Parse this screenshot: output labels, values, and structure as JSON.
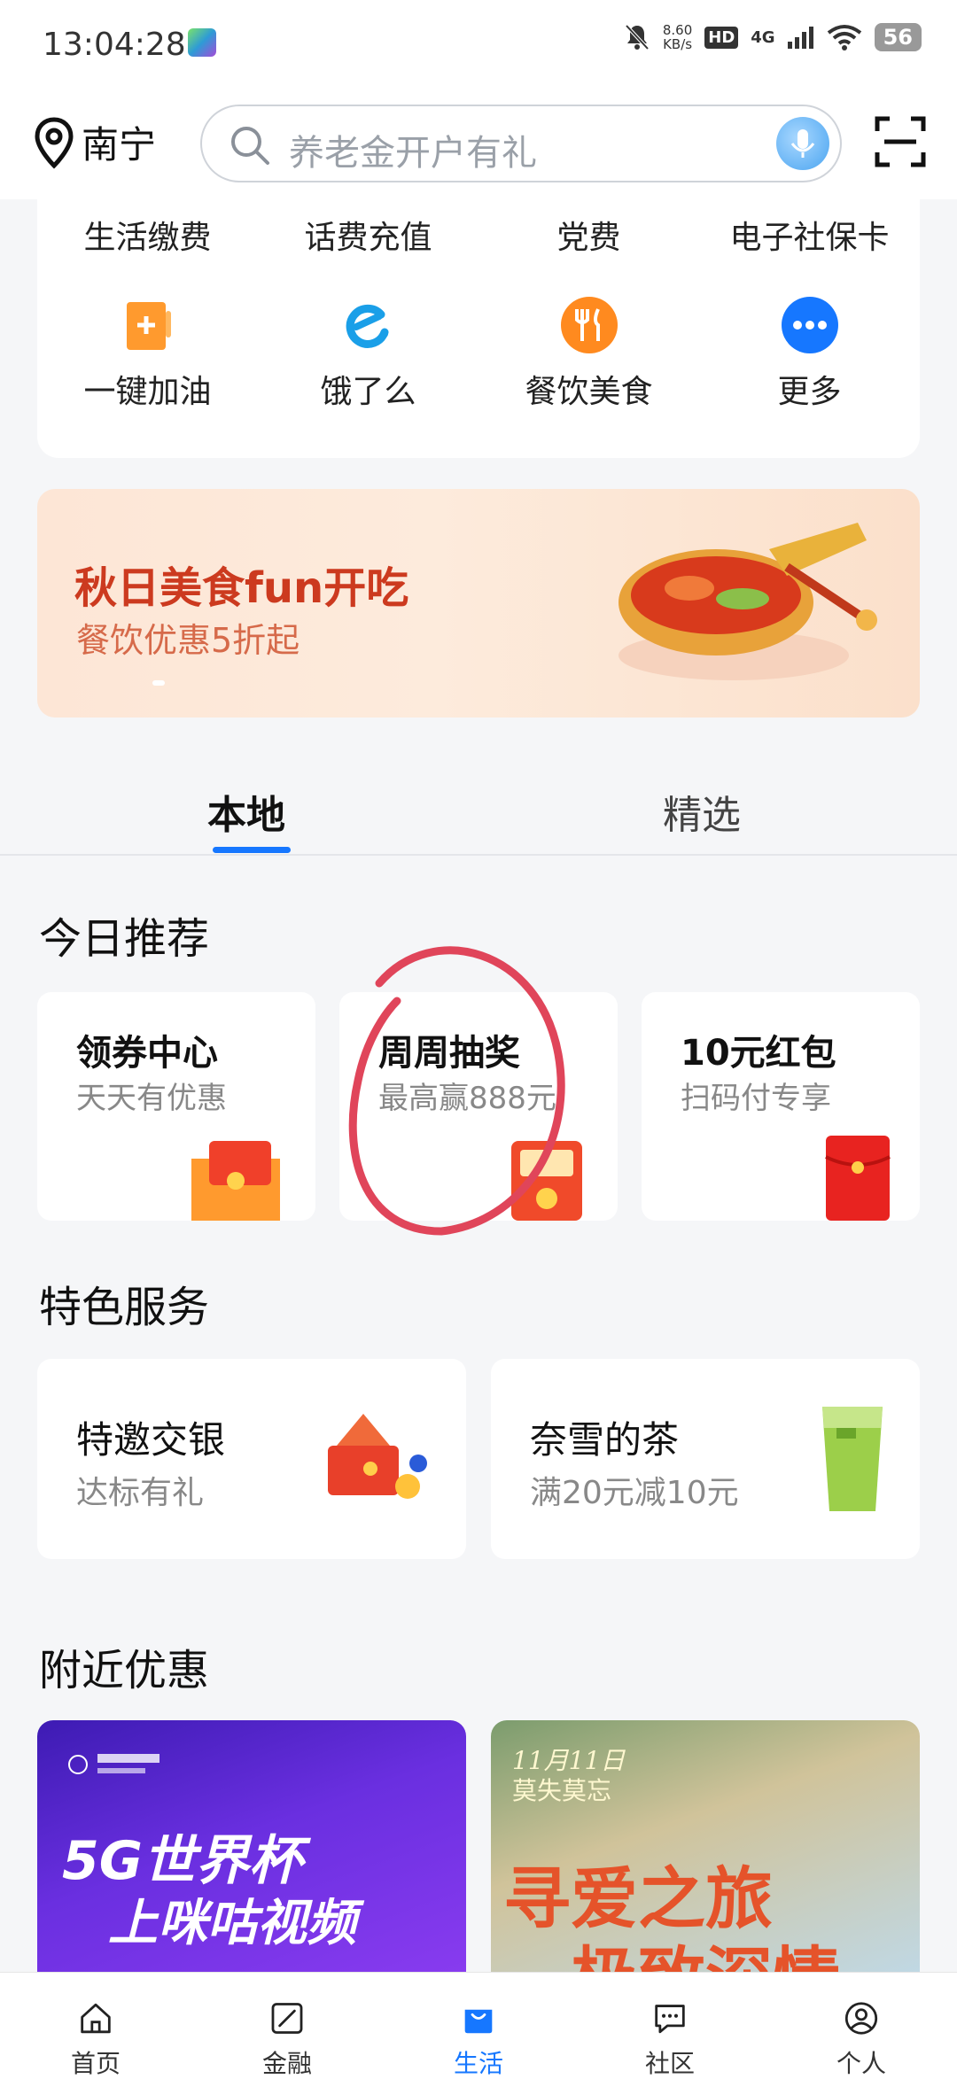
{
  "status_bar": {
    "time": "13:04:28",
    "net_speed_value": "8.60",
    "net_speed_unit": "KB/s",
    "hd": "HD",
    "network": "4G",
    "battery": "56"
  },
  "header": {
    "city": "南宁",
    "search_placeholder": "养老金开户有礼"
  },
  "services": {
    "row1": [
      "生活缴费",
      "话费充值",
      "党费",
      "电子社保卡"
    ],
    "row2": [
      {
        "label": "一键加油",
        "icon": "fuel-icon"
      },
      {
        "label": "饿了么",
        "icon": "eleme-icon"
      },
      {
        "label": "餐饮美食",
        "icon": "dining-icon"
      },
      {
        "label": "更多",
        "icon": "more-icon"
      }
    ]
  },
  "banner": {
    "title": "秋日美食fun开吃",
    "subtitle": "餐饮优惠5折起"
  },
  "tabs": {
    "local": "本地",
    "featured": "精选"
  },
  "today": {
    "title": "今日推荐",
    "cards": [
      {
        "title": "领券中心",
        "subtitle": "天天有优惠"
      },
      {
        "title": "周周抽奖",
        "subtitle": "最高赢888元"
      },
      {
        "title": "10元红包",
        "subtitle": "扫码付专享"
      }
    ]
  },
  "special": {
    "title": "特色服务",
    "cards": [
      {
        "title": "特邀交银",
        "subtitle": "达标有礼"
      },
      {
        "title": "奈雪的茶",
        "subtitle": "满20元减10元"
      }
    ]
  },
  "nearby": {
    "title": "附近优惠",
    "left_poster": {
      "line1": "5G世界杯",
      "line2": "上咪咕视频"
    },
    "right_poster": {
      "date": "11月11日",
      "tag": "莫失莫忘",
      "line1": "寻爱之旅",
      "line2": "极致深情"
    }
  },
  "bottom_nav": [
    {
      "label": "首页",
      "icon": "home-icon"
    },
    {
      "label": "金融",
      "icon": "finance-icon"
    },
    {
      "label": "生活",
      "icon": "life-icon"
    },
    {
      "label": "社区",
      "icon": "community-icon"
    },
    {
      "label": "个人",
      "icon": "profile-icon"
    }
  ],
  "colors": {
    "accent": "#1677ff",
    "banner_title": "#cc3a1f",
    "annotation": "#e0455a"
  }
}
